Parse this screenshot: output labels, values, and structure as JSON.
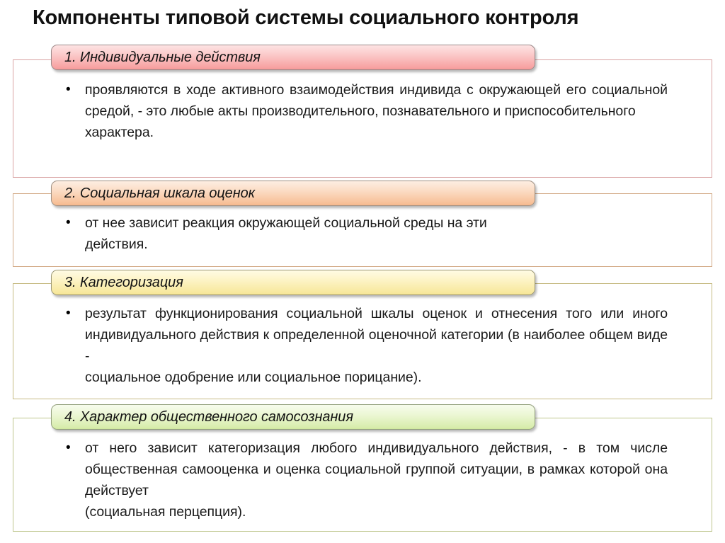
{
  "slide": {
    "title": "Компоненты типовой системы социального контроля",
    "sections": [
      {
        "header": "1. Индивидуальные действия",
        "accent": "#f79f9f",
        "border": "#d9a2a2",
        "body_main": "проявляются в ходе активного взаимодействия индивида с окружающей его социальной средой, - это любые акты производительного, познавательного и приспособительного",
        "body_last": "характера."
      },
      {
        "header": "2. Социальная шкала оценок",
        "accent": "#f7bd93",
        "border": "#d3ab88",
        "body_main": "от нее зависит реакция окружающей социальной среды на эти",
        "body_last": "действия."
      },
      {
        "header": "3. Категоризация",
        "accent": "#f7e79a",
        "border": "#c6bb83",
        "body_main": "результат функционирования социальной шкалы оценок и отнесения того или иного индивидуального действия к определенной оценочной категории (в наиболее общем виде -",
        "body_last": "социальное одобрение или социальное порицание)."
      },
      {
        "header": "4. Характер общественного самосознания",
        "accent": "#d7ecaa",
        "border": "#bfc68e",
        "body_main": "от него зависит категоризация любого индивидуального действия, - в том числе общественная самооценка и оценка социальной группой ситуации, в рамках которой она действует",
        "body_last": "(социальная перцепция)."
      }
    ]
  }
}
